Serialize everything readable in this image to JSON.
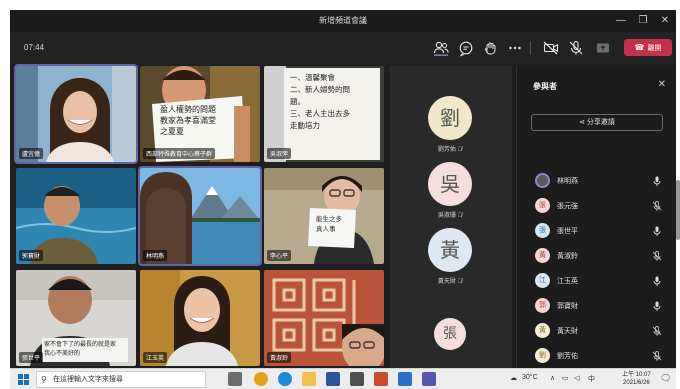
{
  "window": {
    "title": "新增頻道會議",
    "minimize_glyph": "—",
    "maximize_glyph": "❐",
    "close_glyph": "✕"
  },
  "toolbar": {
    "timer": "07:44",
    "icons": [
      "people-icon",
      "chat-icon",
      "raise-hand-icon",
      "more-icon",
      "camera-off-icon",
      "mic-off-icon",
      "share-tray-icon"
    ],
    "leave_label": "離開",
    "leave_color": "#c4314b"
  },
  "tiles": [
    {
      "label": "盧宜億",
      "active": true
    },
    {
      "label": "西部特殊教育中心蔡子群"
    },
    {
      "label": "吳淑萍"
    },
    {
      "label": "郭寶財"
    },
    {
      "label": "林明燕",
      "active": true
    },
    {
      "label": "李心平"
    },
    {
      "label": "張世平"
    },
    {
      "label": "江玉英"
    },
    {
      "label": "黃淑鈴"
    }
  ],
  "tile_texts": {
    "t2": [
      "盈人權勢的問題",
      "教家為孝喜滿堂",
      "之夏夏"
    ],
    "t3": [
      "一、溫馨聚會",
      "二、新人婦勢的問",
      "題。",
      "三、老人主出去多",
      "走動培力"
    ],
    "t6": [
      "能生之多",
      "真人事"
    ],
    "t7": [
      "家不會下了的最長的就是家",
      "我心不美好的"
    ]
  },
  "gallery": [
    {
      "char": "劉",
      "name": "劉芳佑",
      "bg": "#f2e6c8"
    },
    {
      "char": "吳",
      "name": "吳淑珊",
      "bg": "#f7dede"
    },
    {
      "char": "黃",
      "name": "黃天財",
      "bg": "#dde8f3"
    },
    {
      "char": "張",
      "name": "",
      "bg": "#f7dede"
    }
  ],
  "panel": {
    "title": "參與者",
    "close_glyph": "✕",
    "share_label": "分享邀請",
    "participants": [
      {
        "initial": "",
        "name": "林明燕",
        "mic": "on",
        "me": true
      },
      {
        "initial": "張",
        "name": "張元強",
        "mic": "off"
      },
      {
        "initial": "張",
        "name": "張世平",
        "mic": "on"
      },
      {
        "initial": "黃",
        "name": "黃淑鈴",
        "mic": "off"
      },
      {
        "initial": "江",
        "name": "江玉英",
        "mic": "on"
      },
      {
        "initial": "郭",
        "name": "郭寶財",
        "mic": "on"
      },
      {
        "initial": "黃",
        "name": "黃天財",
        "mic": "off"
      },
      {
        "initial": "劉",
        "name": "劉芳佑",
        "mic": "off"
      }
    ]
  },
  "taskbar": {
    "search_placeholder": "在這裡輸入文字來搜尋",
    "temperature": "30°C",
    "ime": "中",
    "time_period": "上午",
    "time": "10:07",
    "date": "2021/6/26"
  }
}
